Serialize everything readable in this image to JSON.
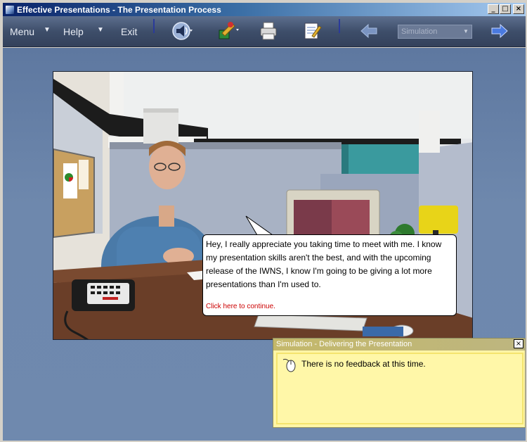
{
  "window": {
    "title": "Effective Presentations - The Presentation Process",
    "minimize_glyph": "_",
    "maximize_glyph": "□",
    "close_glyph": "×"
  },
  "toolbar": {
    "menu_label": "Menu",
    "help_label": "Help",
    "exit_label": "Exit",
    "dropdown_arrow": "▼",
    "icons": [
      "audio-icon",
      "tools-icon",
      "print-icon",
      "notes-icon",
      "back-arrow-icon",
      "forward-arrow-icon"
    ],
    "mode_select": {
      "selected": "Simulation"
    }
  },
  "scene": {
    "speech_text": "Hey, I really appreciate you taking time to meet with me. I know my presentation skills aren't the best, and with the upcoming release of the IWNS, I know I'm going to be giving a lot more presentations than I'm used to.",
    "continue_link": "Click here to continue."
  },
  "feedback": {
    "title": "Simulation - Delivering the Presentation",
    "close_glyph": "×",
    "message": "There is no feedback at this time."
  },
  "colors": {
    "title_bar": "#0a246a",
    "toolbar_bg": "#3e4e6a",
    "main_bg": "#6e88ad",
    "feedback_bg": "#fff5a6",
    "link_red": "#cc0000"
  }
}
